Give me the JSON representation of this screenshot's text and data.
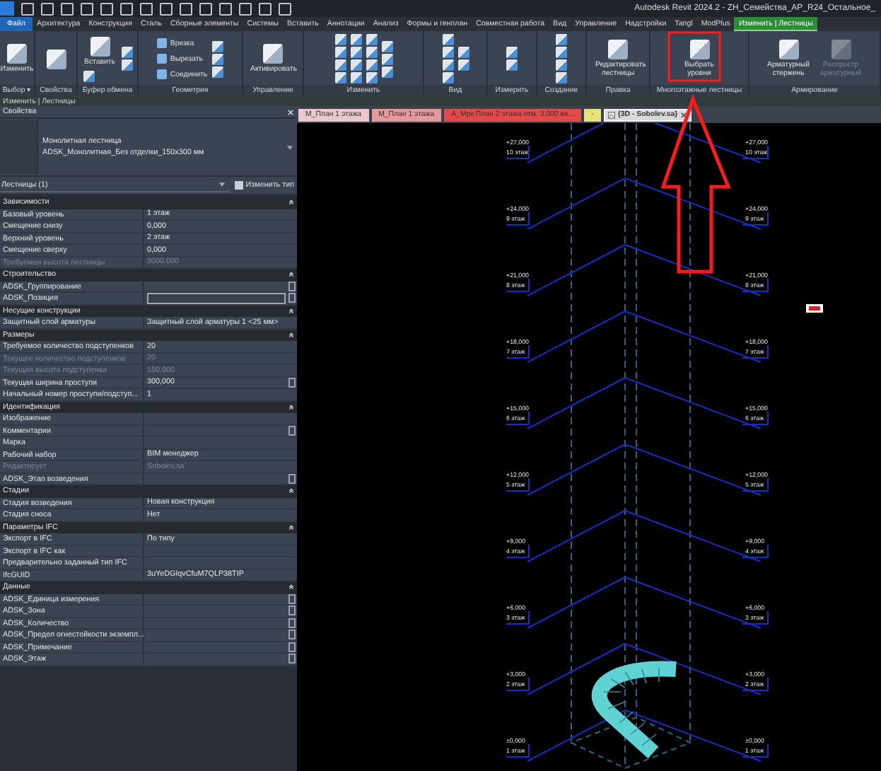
{
  "window": {
    "title": "Autodesk Revit 2024.2 - ZH_Семейства_АР_R24_Остальное_"
  },
  "tabs": [
    {
      "label": "Файл",
      "kind": "file",
      "selected": false
    },
    {
      "label": "Архитектура",
      "kind": "normal",
      "selected": false
    },
    {
      "label": "Конструкция",
      "kind": "normal",
      "selected": false
    },
    {
      "label": "Сталь",
      "kind": "normal",
      "selected": false
    },
    {
      "label": "Сборные элементы",
      "kind": "normal",
      "selected": false
    },
    {
      "label": "Системы",
      "kind": "normal",
      "selected": false
    },
    {
      "label": "Вставить",
      "kind": "normal",
      "selected": false
    },
    {
      "label": "Аннотации",
      "kind": "normal",
      "selected": false
    },
    {
      "label": "Анализ",
      "kind": "normal",
      "selected": false
    },
    {
      "label": "Формы и генплан",
      "kind": "normal",
      "selected": false
    },
    {
      "label": "Совместная работа",
      "kind": "normal",
      "selected": false
    },
    {
      "label": "Вид",
      "kind": "normal",
      "selected": false
    },
    {
      "label": "Управление",
      "kind": "normal",
      "selected": false
    },
    {
      "label": "Надстройки",
      "kind": "normal",
      "selected": false
    },
    {
      "label": "Tangl",
      "kind": "normal",
      "selected": false
    },
    {
      "label": "ModPlus",
      "kind": "normal",
      "selected": false
    },
    {
      "label": "Изменить | Лестницы",
      "kind": "context",
      "selected": true
    }
  ],
  "ribbon": {
    "panels": [
      {
        "label": "Выбор ▾",
        "tools": [
          {
            "kind": "large",
            "label": "Изменить",
            "disabled": false
          }
        ]
      },
      {
        "label": "Свойства",
        "tools": [
          {
            "kind": "large",
            "disabled": false
          }
        ]
      },
      {
        "label": "Буфер обмена",
        "tools": [
          {
            "kind": "large",
            "label": "Вставить",
            "disabled": false
          },
          {
            "kind": "icon",
            "disabled": false
          },
          {
            "kind": "icon",
            "disabled": false
          },
          {
            "kind": "icon",
            "disabled": false
          }
        ]
      },
      {
        "label": "Геометрия",
        "tools": [
          {
            "kind": "small",
            "label": "Врезка",
            "disabled": false
          },
          {
            "kind": "small",
            "label": "Вырезать",
            "disabled": false
          },
          {
            "kind": "small",
            "label": "Соединить",
            "disabled": false
          },
          {
            "kind": "icon",
            "disabled": false
          },
          {
            "kind": "icon",
            "disabled": false
          },
          {
            "kind": "icon",
            "disabled": false
          }
        ]
      },
      {
        "label": "Управление",
        "tools": [
          {
            "kind": "large",
            "label": "Активировать",
            "disabled": false
          }
        ]
      },
      {
        "label": "Изменить",
        "tools": [
          {
            "kind": "icon",
            "disabled": false
          },
          {
            "kind": "icon",
            "disabled": false
          },
          {
            "kind": "icon",
            "disabled": false
          },
          {
            "kind": "icon",
            "disabled": false
          },
          {
            "kind": "icon",
            "disabled": false
          },
          {
            "kind": "icon",
            "disabled": false
          },
          {
            "kind": "icon",
            "disabled": false
          },
          {
            "kind": "icon",
            "disabled": false
          },
          {
            "kind": "icon",
            "disabled": false
          },
          {
            "kind": "icon",
            "disabled": false
          },
          {
            "kind": "icon",
            "disabled": false
          },
          {
            "kind": "icon",
            "disabled": false
          },
          {
            "kind": "icon",
            "disabled": false
          },
          {
            "kind": "icon",
            "disabled": false
          },
          {
            "kind": "icon",
            "disabled": false
          }
        ]
      },
      {
        "label": "Вид",
        "tools": [
          {
            "kind": "icon",
            "disabled": false
          },
          {
            "kind": "icon",
            "disabled": false
          },
          {
            "kind": "icon",
            "disabled": false
          },
          {
            "kind": "icon",
            "disabled": false
          },
          {
            "kind": "icon",
            "disabled": false
          },
          {
            "kind": "icon",
            "disabled": false
          }
        ]
      },
      {
        "label": "Измерить",
        "tools": [
          {
            "kind": "icon",
            "disabled": false
          },
          {
            "kind": "icon",
            "disabled": false
          }
        ]
      },
      {
        "label": "Создание",
        "tools": [
          {
            "kind": "icon",
            "disabled": false
          },
          {
            "kind": "icon",
            "disabled": false
          },
          {
            "kind": "icon",
            "disabled": false
          },
          {
            "kind": "icon",
            "disabled": false
          }
        ]
      },
      {
        "label": "Правка",
        "tools": [
          {
            "kind": "large",
            "label": "Редактировать лестницы",
            "disabled": false
          }
        ]
      },
      {
        "label": "Многоэтажные лестницы",
        "tools": [
          {
            "kind": "large",
            "label": "Выбрать уровни",
            "disabled": false
          }
        ]
      },
      {
        "label": "Армирование",
        "tools": [
          {
            "kind": "large",
            "label": "Арматурный стержень",
            "disabled": false
          },
          {
            "kind": "large",
            "label": "Распростр арматурный",
            "disabled": true
          }
        ]
      }
    ]
  },
  "context_bar": "Изменить | Лестницы",
  "properties": {
    "title": "Свойства",
    "type_family": "Монолитная лестница",
    "type_name": "ADSK_Монолитная_Без отделки_150x300 мм",
    "filter": "Лестницы (1)",
    "edit_type": "Изменить тип",
    "sections": [
      {
        "title": "Зависимости",
        "rows": [
          {
            "label": "Базовый уровень",
            "value": "1 этаж",
            "kind": "text",
            "disabled": false,
            "assoc": false
          },
          {
            "label": "Смещение снизу",
            "value": "0,000",
            "kind": "text",
            "disabled": false,
            "assoc": false
          },
          {
            "label": "Верхний уровень",
            "value": "2 этаж",
            "kind": "text",
            "disabled": false,
            "assoc": false
          },
          {
            "label": "Смещение сверху",
            "value": "0,000",
            "kind": "text",
            "disabled": false,
            "assoc": false
          },
          {
            "label": "Требуемая высота лестницы",
            "value": "3000,000",
            "kind": "text",
            "disabled": true,
            "assoc": false
          }
        ]
      },
      {
        "title": "Строительство",
        "rows": [
          {
            "label": "ADSK_Группирование",
            "kind": "text",
            "disabled": false,
            "assoc": true
          },
          {
            "label": "ADSK_Позиция",
            "kind": "field",
            "disabled": false,
            "assoc": true
          }
        ]
      },
      {
        "title": "Несущие конструкции",
        "rows": [
          {
            "label": "Защитный слой арматуры",
            "value": "Защитный слой арматуры 1 <25 мм>",
            "kind": "text",
            "disabled": false,
            "assoc": false
          }
        ]
      },
      {
        "title": "Размеры",
        "rows": [
          {
            "label": "Требуемое количество подступенков",
            "value": "20",
            "kind": "text",
            "disabled": false,
            "assoc": false
          },
          {
            "label": "Текущее количество подступенков",
            "value": "20",
            "kind": "text",
            "disabled": true,
            "assoc": false
          },
          {
            "label": "Текущая высота подступенка",
            "value": "150,000",
            "kind": "text",
            "disabled": true,
            "assoc": false
          },
          {
            "label": "Текущая ширина проступи",
            "value": "300,000",
            "kind": "text",
            "disabled": false,
            "assoc": true
          },
          {
            "label": "Начальный номер проступи/подступ...",
            "value": "1",
            "kind": "text",
            "disabled": false,
            "assoc": false
          }
        ]
      },
      {
        "title": "Идентификация",
        "rows": [
          {
            "label": "Изображение",
            "kind": "text",
            "disabled": false,
            "assoc": false
          },
          {
            "label": "Комментарии",
            "kind": "text",
            "disabled": false,
            "assoc": true
          },
          {
            "label": "Марка",
            "kind": "text",
            "disabled": false,
            "assoc": false
          },
          {
            "label": "Рабочий набор",
            "value": "BIM менеджер",
            "kind": "text",
            "disabled": false,
            "assoc": false
          },
          {
            "label": "Редактирует",
            "value": "Sobolev.sa",
            "kind": "text",
            "disabled": true,
            "assoc": false
          },
          {
            "label": "ADSK_Этап возведения",
            "kind": "text",
            "disabled": false,
            "assoc": true
          }
        ]
      },
      {
        "title": "Стадии",
        "rows": [
          {
            "label": "Стадия возведения",
            "value": "Новая конструкция",
            "kind": "text",
            "disabled": false,
            "assoc": false
          },
          {
            "label": "Стадия сноса",
            "value": "Нет",
            "kind": "text",
            "disabled": false,
            "assoc": false
          }
        ]
      },
      {
        "title": "Параметры IFC",
        "rows": [
          {
            "label": "Экспорт в IFC",
            "value": "По типу",
            "kind": "text",
            "disabled": false,
            "assoc": false
          },
          {
            "label": "Экспорт в IFC как",
            "kind": "text",
            "disabled": false,
            "assoc": false
          },
          {
            "label": "Предварительно заданный тип IFC",
            "kind": "text",
            "disabled": false,
            "assoc": false
          },
          {
            "label": "IfcGUID",
            "value": "3uYeDGIqvCfuM7QLP38TIP",
            "kind": "text",
            "disabled": false,
            "assoc": false
          }
        ]
      },
      {
        "title": "Данные",
        "rows": [
          {
            "label": "ADSK_Единица измерения",
            "kind": "text",
            "disabled": false,
            "assoc": true
          },
          {
            "label": "ADSK_Зона",
            "kind": "text",
            "disabled": false,
            "assoc": true
          },
          {
            "label": "ADSK_Количество",
            "kind": "text",
            "disabled": false,
            "assoc": true
          },
          {
            "label": "ADSK_Предел огнестойкости экземпл...",
            "kind": "text",
            "disabled": false,
            "assoc": true
          },
          {
            "label": "ADSK_Примечание",
            "kind": "text",
            "disabled": false,
            "assoc": true
          },
          {
            "label": "ADSK_Этаж",
            "kind": "text",
            "disabled": false,
            "assoc": true
          }
        ]
      }
    ]
  },
  "view_tabs": [
    {
      "label": "М_План 1 этажа",
      "color": "#e9c9c9",
      "selected": false
    },
    {
      "label": "М_План 1 этажа",
      "color": "#e49a9a",
      "selected": false
    },
    {
      "label": "А_Мрк План 2 этажа отм. 3,000 ве...",
      "color": "#e14b4b",
      "selected": false
    },
    {
      "label": "-",
      "color": "#e8e27c",
      "selected": false
    },
    {
      "label": "{3D - Sobolev.sa}",
      "color": "#d9d9d9",
      "selected": true
    }
  ],
  "levels": [
    {
      "elevation_left": "+27,000",
      "name_left": "10 этаж",
      "elevation_right": "+27,000",
      "name_right": "10 этаж"
    },
    {
      "elevation_left": "+24,000",
      "name_left": "9 этаж",
      "elevation_right": "+24,000",
      "name_right": "9 этаж"
    },
    {
      "elevation_left": "+21,000",
      "name_left": "8 этаж",
      "elevation_right": "+21,000",
      "name_right": "8 этаж"
    },
    {
      "elevation_left": "+18,000",
      "name_left": "7 этаж",
      "elevation_right": "+18,000",
      "name_right": "7 этаж"
    },
    {
      "elevation_left": "+15,000",
      "name_left": "6 этаж",
      "elevation_right": "+15,000",
      "name_right": "6 этаж"
    },
    {
      "elevation_left": "+12,000",
      "name_left": "5 этаж",
      "elevation_right": "+12,000",
      "name_right": "5 этаж"
    },
    {
      "elevation_left": "+9,000",
      "name_left": "4 этаж",
      "elevation_right": "+9,000",
      "name_right": "4 этаж"
    },
    {
      "elevation_left": "+6,000",
      "name_left": "3 этаж",
      "elevation_right": "+6,000",
      "name_right": "3 этаж"
    },
    {
      "elevation_left": "+3,000",
      "name_left": "2 этаж",
      "elevation_right": "+3,000",
      "name_right": "2 этаж"
    },
    {
      "elevation_left": "±0,000",
      "name_left": "1 этаж",
      "elevation_right": "±0,000",
      "name_right": "1 этаж"
    }
  ]
}
